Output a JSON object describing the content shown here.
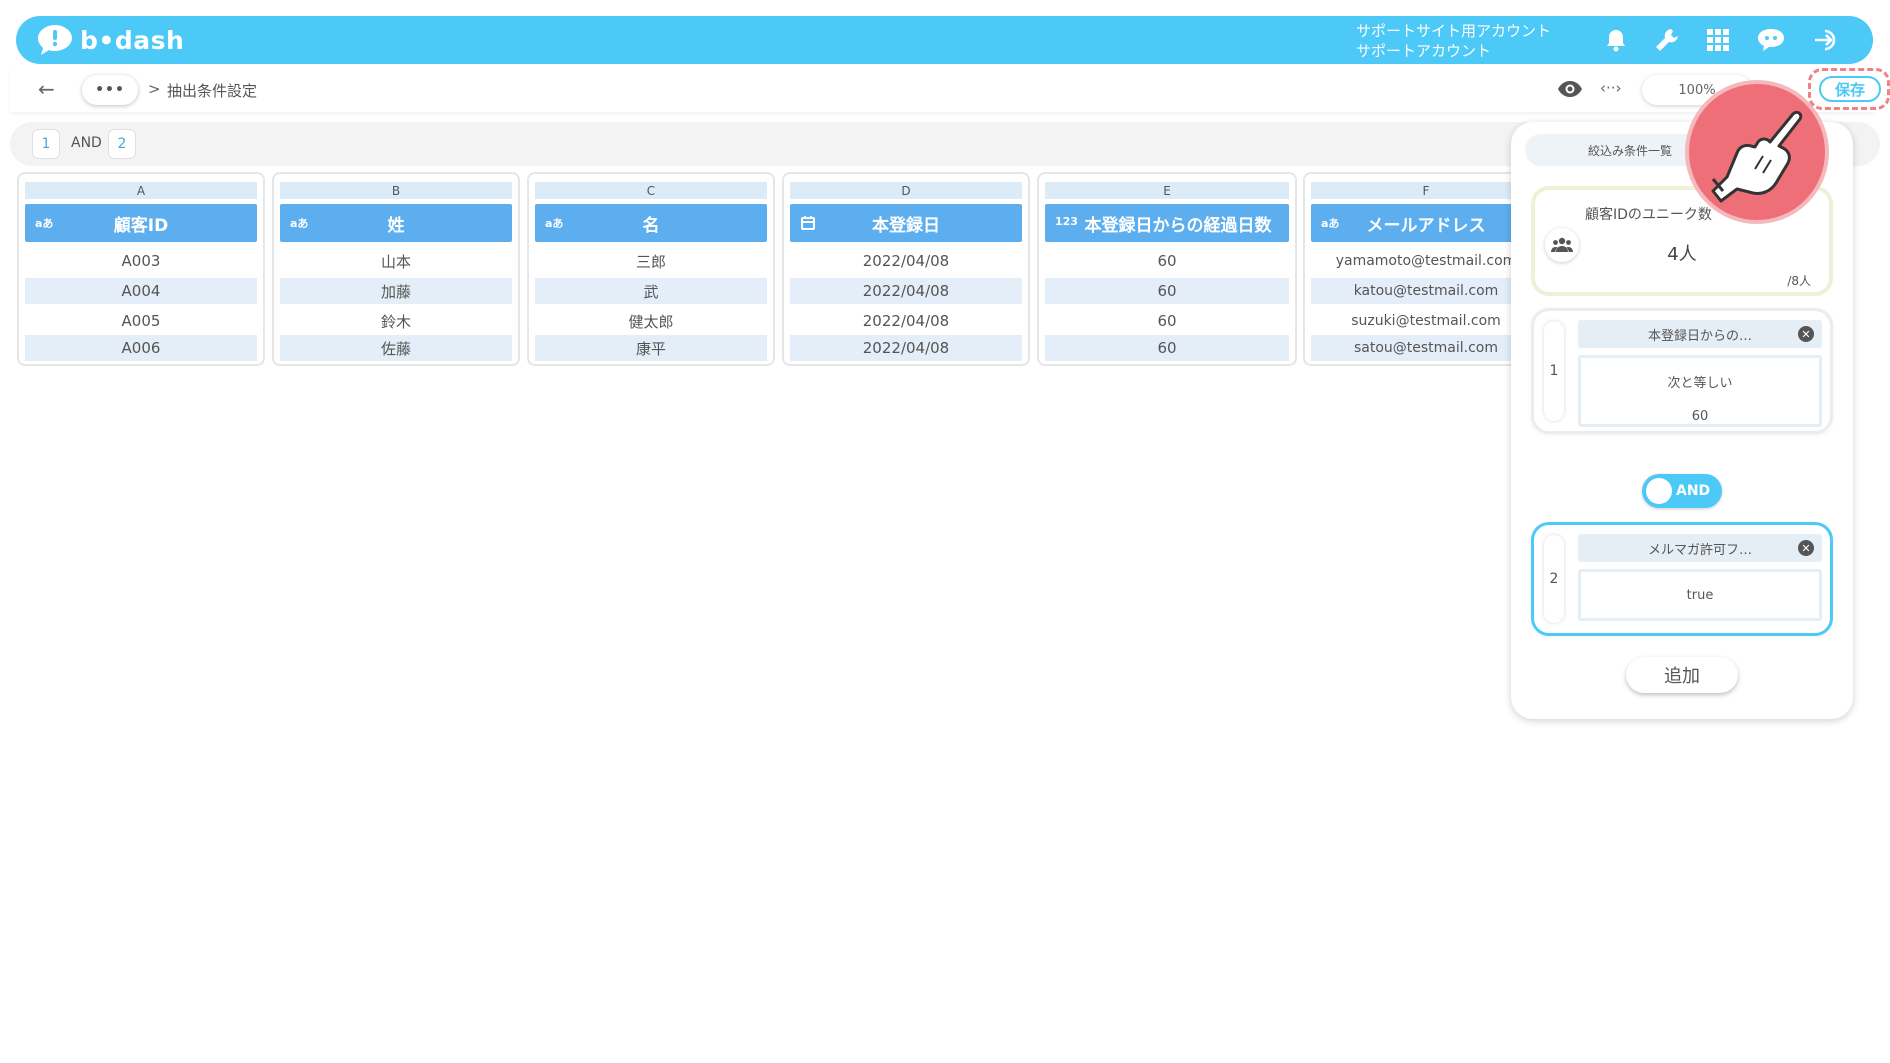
{
  "header": {
    "logo_text": "b•dash",
    "account_line1": "サポートサイト用アカウント",
    "account_line2": "サポートアカウント",
    "icons": [
      "bell-icon",
      "wrench-icon",
      "grid-icon",
      "chat-bot-icon",
      "logout-icon"
    ]
  },
  "toolbar": {
    "more_label": "•••",
    "crumb_sep": ">",
    "crumb_title": "抽出条件設定",
    "code_label": "‹··›",
    "zoom": "100%",
    "save_label": "保存"
  },
  "condition_bar": {
    "chip1": "1",
    "operator": "AND",
    "chip2": "2"
  },
  "columns": [
    {
      "letter": "A",
      "type": "aあ",
      "name": "顧客ID",
      "cells": [
        "A003",
        "A004",
        "A005",
        "A006"
      ]
    },
    {
      "letter": "B",
      "type": "aあ",
      "name": "姓",
      "cells": [
        "山本",
        "加藤",
        "鈴木",
        "佐藤"
      ]
    },
    {
      "letter": "C",
      "type": "aあ",
      "name": "名",
      "cells": [
        "三郎",
        "武",
        "健太郎",
        "康平"
      ]
    },
    {
      "letter": "D",
      "type": "calendar",
      "name": "本登録日",
      "cells": [
        "2022/04/08",
        "2022/04/08",
        "2022/04/08",
        "2022/04/08"
      ]
    },
    {
      "letter": "E",
      "type": "123",
      "name": "本登録日からの経過日数",
      "cells": [
        "60",
        "60",
        "60",
        "60"
      ]
    },
    {
      "letter": "F",
      "type": "aあ",
      "name": "メールアドレス",
      "cells": [
        "yamamoto@testmail.com",
        "katou@testmail.com",
        "suzuki@testmail.com",
        "satou@testmail.com"
      ]
    }
  ],
  "panel": {
    "tab_label": "絞込み条件一覧",
    "unique": {
      "title": "顧客IDのユニーク数",
      "count": "4人",
      "total": "/8人"
    },
    "conditions": [
      {
        "index": "1",
        "field": "本登録日からの…",
        "operator": "次と等しい",
        "value": "60"
      },
      {
        "index": "2",
        "field": "メルマガ許可フ…",
        "value": "true"
      }
    ],
    "join_operator": "AND",
    "add_label": "追加"
  },
  "colors": {
    "brand": "#4cc9f6",
    "header_col": "#5daeef",
    "highlight": "#ef8287"
  }
}
